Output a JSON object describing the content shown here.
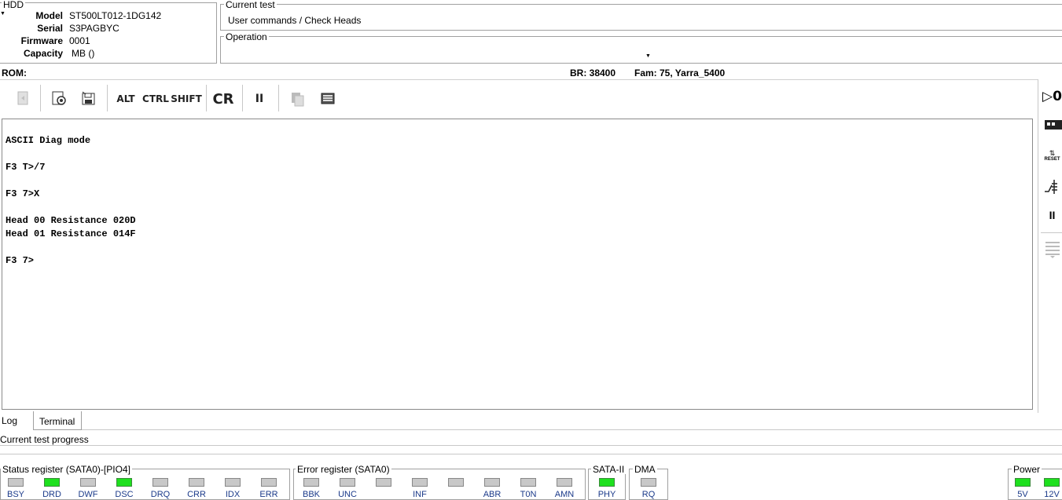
{
  "hdd": {
    "title": "HDD",
    "model_label": "Model",
    "model_value": "ST500LT012-1DG142",
    "serial_label": "Serial",
    "serial_value": "S3PAGBYC",
    "firmware_label": "Firmware",
    "firmware_value": "0001",
    "capacity_label": "Capacity",
    "capacity_value": "MB ()"
  },
  "current_test": {
    "title": "Current test",
    "value": "User commands / Check Heads"
  },
  "operation": {
    "title": "Operation",
    "value": ""
  },
  "status_line": {
    "rom_label": "ROM:",
    "br": "BR: 38400",
    "fam": "Fam: 75, Yarra_5400"
  },
  "toolbar": {
    "alt_label": "ALT",
    "ctrl_label": "CTRL",
    "shift_label": "SHIFT",
    "cr_label": "CR",
    "pause_label": "II"
  },
  "terminal": {
    "lines": [
      "ASCII Diag mode",
      "F3 T>/7",
      "F3 7>X",
      "Head 00 Resistance 020D",
      "Head 01 Resistance 014F",
      "F3 7>"
    ]
  },
  "tabs": {
    "log": "Log",
    "terminal": "Terminal"
  },
  "progress": {
    "label": "Current test progress"
  },
  "status_register": {
    "title": "Status register (SATA0)-[PIO4]",
    "leds": [
      {
        "label": "BSY",
        "on": false
      },
      {
        "label": "DRD",
        "on": true
      },
      {
        "label": "DWF",
        "on": false
      },
      {
        "label": "DSC",
        "on": true
      },
      {
        "label": "DRQ",
        "on": false
      },
      {
        "label": "CRR",
        "on": false
      },
      {
        "label": "IDX",
        "on": false
      },
      {
        "label": "ERR",
        "on": false
      }
    ]
  },
  "error_register": {
    "title": "Error register (SATA0)",
    "leds": [
      {
        "label": "BBK",
        "on": false
      },
      {
        "label": "UNC",
        "on": false
      },
      {
        "label": "",
        "on": false
      },
      {
        "label": "INF",
        "on": false
      },
      {
        "label": "",
        "on": false
      },
      {
        "label": "ABR",
        "on": false
      },
      {
        "label": "T0N",
        "on": false
      },
      {
        "label": "AMN",
        "on": false
      }
    ]
  },
  "sata": {
    "title": "SATA-II",
    "led_label": "PHY",
    "on": true
  },
  "dma": {
    "title": "DMA",
    "led_label": "RQ",
    "on": false
  },
  "power": {
    "title": "Power",
    "led1_label": "5V",
    "led2_label": "12V",
    "on": true
  },
  "right_sidebar": {
    "reset_label": "RESET",
    "pause_label": "II"
  },
  "colors": {
    "led_on": "#1ee01e",
    "led_off": "#c8c8c8",
    "led_label": "#1b3a8a"
  }
}
